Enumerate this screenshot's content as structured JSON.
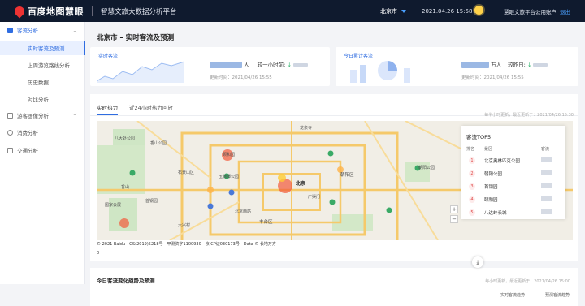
{
  "header": {
    "logo_text": "百度地图慧眼",
    "platform_title": "智慧文旅大数据分析平台",
    "city": "北京市",
    "datetime": "2021.04.26 15:58 晴",
    "account": "慧眼文旅平台公用账户",
    "logout": "退出"
  },
  "sidebar": {
    "items": [
      {
        "label": "客流分析",
        "icon": "flow-icon",
        "expanded": true
      },
      {
        "label": "游客画像分析",
        "icon": "user-profile-icon",
        "expanded": false
      },
      {
        "label": "消费分析",
        "icon": "consume-icon"
      },
      {
        "label": "交通分析",
        "icon": "traffic-icon"
      }
    ],
    "sub_items": [
      {
        "label": "实时客流及预测",
        "active": true
      },
      {
        "label": "上周游览路线分析"
      },
      {
        "label": "历史数据"
      },
      {
        "label": "对比分析"
      }
    ]
  },
  "main": {
    "page_title": "北京市 – 实时客流及预测",
    "card_realtime": {
      "label": "实时客流",
      "unit": "人",
      "compare_label": "较一小时前:",
      "update_time": "更新时间：2021/04/26 15:55"
    },
    "card_today": {
      "label": "今日累计客流",
      "unit": "万人",
      "compare_label": "较昨日:",
      "update_time": "更新时间：2021/04/26 15:55"
    },
    "tabs": [
      {
        "label": "实时热力"
      },
      {
        "label": "近24小时热力回放"
      }
    ],
    "update_note": "每半小时更新，最近更新于：2021/04/26 15:30",
    "map_copyright": "© 2021 Baidu - GS(2019)5218号 - 甲测资字1100930 - 京ICP证030173号 - Data © 长地万方",
    "map_scale_zero": "0",
    "map_labels": [
      "八大处公园",
      "香山公园",
      "石景山区",
      "玉渊潭公园",
      "朝阳区",
      "朝阳公园",
      "北京",
      "丰台区",
      "广渠门",
      "大兴村",
      "首钢园",
      "国家会展",
      "北京西站",
      "颐和园",
      "香山",
      "龙泉寺"
    ],
    "top5": {
      "title": "客流TOP5",
      "headers": [
        "排名",
        "景区",
        "客流"
      ],
      "rows": [
        {
          "rank": "1",
          "name": "北京奥林匹克公园"
        },
        {
          "rank": "2",
          "name": "朝阳公园"
        },
        {
          "rank": "3",
          "name": "首钢园"
        },
        {
          "rank": "4",
          "name": "颐和园"
        },
        {
          "rank": "5",
          "name": "八达岭长城"
        }
      ]
    },
    "bottom": {
      "title": "今日客流变化趋势及预测",
      "update_note": "每小时更新，最近更新于：2021/04/26 15:00",
      "legend": [
        {
          "label": "实时客流趋势",
          "color": "#2f6de1",
          "style": "solid"
        },
        {
          "label": "预测客流趋势",
          "color": "#2f6de1",
          "style": "dashed"
        }
      ]
    }
  },
  "colors": {
    "accent": "#2f6de1",
    "topbar": "#0f1a2e",
    "rank_badge": "#e04848"
  }
}
